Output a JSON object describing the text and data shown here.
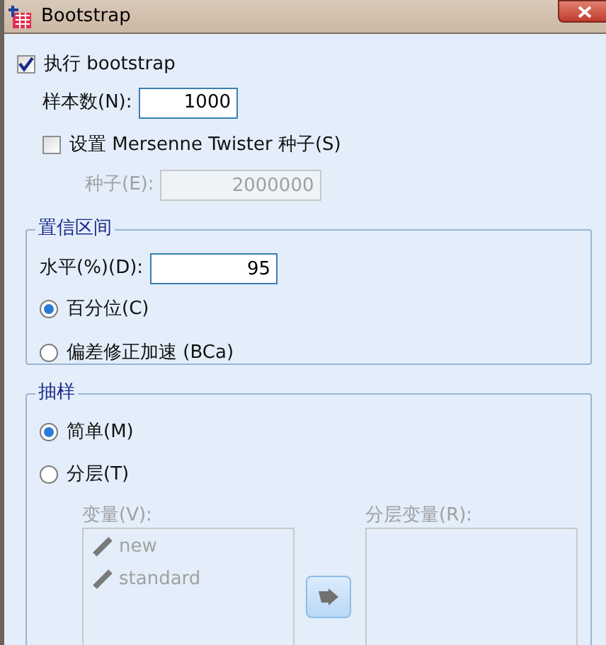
{
  "window": {
    "title": "Bootstrap"
  },
  "perform": {
    "label": "执行 bootstrap",
    "checked": true
  },
  "sample_count": {
    "label": "样本数(N):",
    "value": "1000"
  },
  "mersenne": {
    "label": "设置 Mersenne Twister 种子(S)",
    "checked": false
  },
  "seed": {
    "label": "种子(E):",
    "value": "2000000",
    "disabled": true
  },
  "confidence": {
    "title": "置信区间",
    "level": {
      "label": "水平(%)(D):",
      "value": "95"
    },
    "methods": [
      {
        "label": "百分位(C)",
        "selected": true
      },
      {
        "label": "偏差修正加速 (BCa)",
        "selected": false
      }
    ]
  },
  "sampling": {
    "title": "抽样",
    "methods": [
      {
        "label": "简单(M)",
        "selected": true
      },
      {
        "label": "分层(T)",
        "selected": false
      }
    ],
    "variables": {
      "label": "变量(V):",
      "items": [
        "new",
        "standard"
      ],
      "disabled": true
    },
    "strata": {
      "label": "分层变量(R):",
      "disabled": true
    }
  }
}
